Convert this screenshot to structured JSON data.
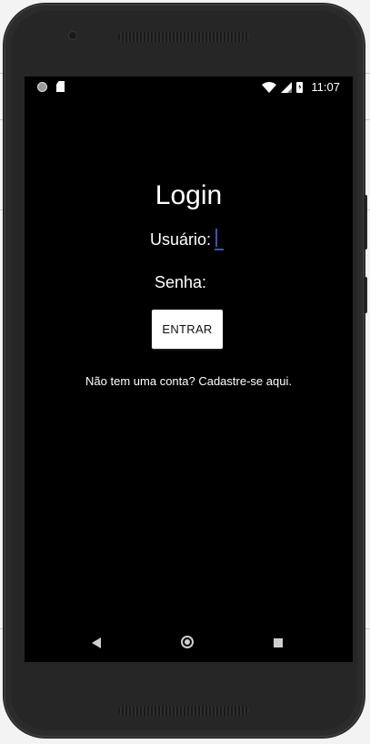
{
  "status_bar": {
    "time": "11:07",
    "left_icons": [
      "notification-dot-icon",
      "sd-card-icon"
    ],
    "right_icons": [
      "wifi-icon",
      "signal-icon",
      "battery-charging-icon"
    ]
  },
  "login": {
    "title": "Login",
    "username_label": "Usuário:",
    "username_value": "",
    "password_label": "Senha:",
    "password_value": "",
    "enter_button": "ENTRAR",
    "signup_prompt": "Não tem uma conta? Cadastre-se aqui."
  },
  "nav_bar": {
    "icons": [
      "back-icon",
      "home-icon",
      "recents-icon"
    ]
  },
  "colors": {
    "screen_background": "#000000",
    "text": "#ffffff",
    "accent": "#3f51b5",
    "button_background": "#ffffff",
    "device_body": "#2b2b2b"
  }
}
